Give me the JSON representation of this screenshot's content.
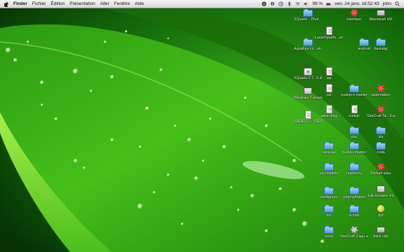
{
  "menubar": {
    "app_name": "Finder",
    "menus": [
      "Fichier",
      "Édition",
      "Présentation",
      "Aller",
      "Fenêtre",
      "Aide"
    ],
    "battery": "99 %",
    "datetime": "ven. 24 janv. 18:52:43",
    "user": "john"
  },
  "desktop": {
    "icons": [
      {
        "label": "XQuartz ...Phot...older",
        "kind": "folder"
      },
      {
        "label": "interface",
        "kind": "gear-red"
      },
      {
        "label": "Macintosh HD",
        "kind": "disk"
      },
      {
        "label": "Launchpadre...arvent",
        "kind": "doc"
      },
      {
        "label": "AquaKey-Lo...etca...1.4.2",
        "kind": "folder"
      },
      {
        "label": "android",
        "kind": "folder"
      },
      {
        "label": "bastabg",
        "kind": "folder"
      },
      {
        "label": "XQuartz-2.7...5.dmg",
        "kind": "dmg"
      },
      {
        "label": "wp",
        "kind": "doc"
      },
      {
        "label": "Windows 7.vmwarevm",
        "kind": "vm"
      },
      {
        "label": "wii",
        "kind": "doc"
      },
      {
        "label": "nudejs-v-master",
        "kind": "folder"
      },
      {
        "label": "automation",
        "kind": "gear-red"
      },
      {
        "label": "save.dmg",
        "kind": "doc"
      },
      {
        "label": "39E9FC2-...33E0...TO.sec",
        "kind": "doc"
      },
      {
        "label": "nudejs",
        "kind": "doc"
      },
      {
        "label": "StarCraft Se...II.app",
        "kind": "gear-red"
      },
      {
        "label": "doc",
        "kind": "folder"
      },
      {
        "label": "bla",
        "kind": "folder"
      },
      {
        "label": "canevas",
        "kind": "folder"
      },
      {
        "label": "nudejs-master",
        "kind": "folder"
      },
      {
        "label": "coda",
        "kind": "folder"
      },
      {
        "label": "accomplets",
        "kind": "folder"
      },
      {
        "label": "raspberry",
        "kind": "folder"
      },
      {
        "label": "Default alias",
        "kind": "gear-red"
      },
      {
        "label": "wordpress",
        "kind": "folder"
      },
      {
        "label": "phpmyAdmin",
        "kind": "folder"
      },
      {
        "label": "kalicsmware vm",
        "kind": "vm"
      },
      {
        "label": "bin",
        "kind": "folder"
      },
      {
        "label": "scripts",
        "kind": "folder"
      },
      {
        "label": "bpf",
        "kind": "yellow"
      },
      {
        "label": "www",
        "kind": "folder"
      },
      {
        "label": "StarCraft II.app alias",
        "kind": "gear"
      },
      {
        "label": "hack usb",
        "kind": "disk"
      }
    ]
  }
}
